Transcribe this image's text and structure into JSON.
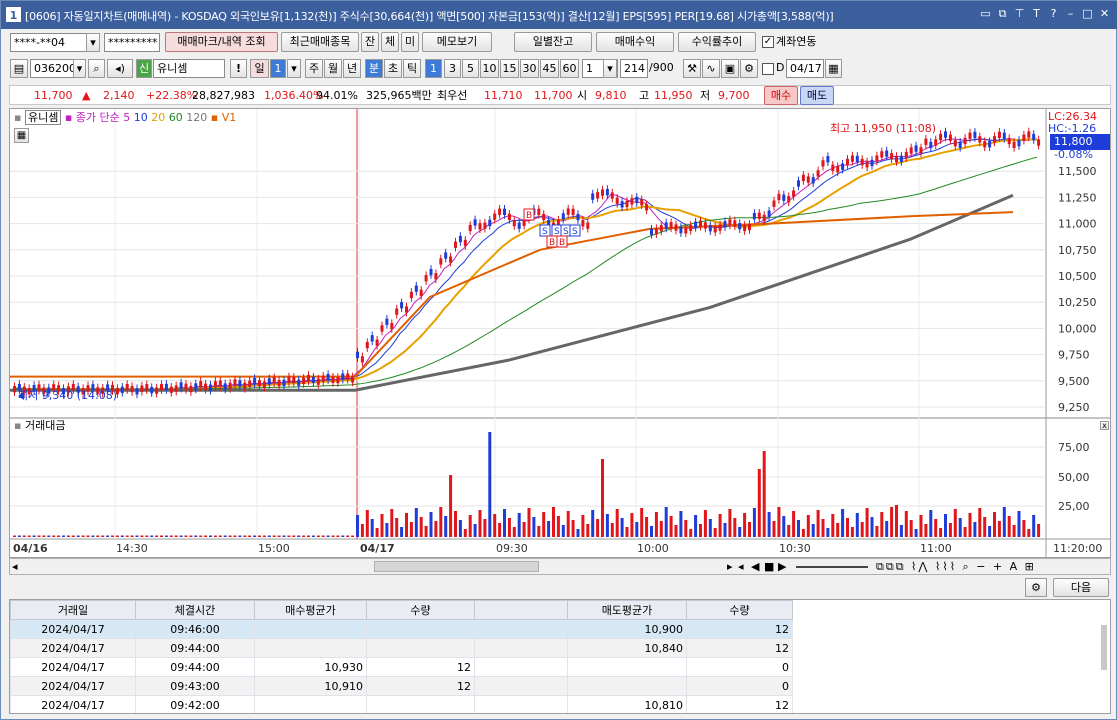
{
  "title": {
    "num": "1",
    "text": "[0606] 자동일지차트(매매내역) - KOSDAQ 외국인보유[1,132(천)] 주식수[30,664(천)] 액면[500] 자본금[153(억)] 결산[12월] EPS[595] PER[19.68] 시가총액[3,588(억)]"
  },
  "toolbar1": {
    "account": "****-**04",
    "password": "*********",
    "mark_btn": "매매마크/내역 조회",
    "recent_btn": "최근매매종목",
    "j": "잔",
    "c": "체",
    "m": "미",
    "memo_btn": "메모보기",
    "daily_btn": "일별잔고",
    "profit_btn": "매매수익",
    "rate_btn": "수익률추이",
    "link_label": "계좌연동"
  },
  "toolbar2": {
    "code": "036200",
    "market": "신",
    "name": "유니셈",
    "day": "일",
    "day_n": "1",
    "week": "주",
    "month": "월",
    "year": "년",
    "minute": "분",
    "second": "초",
    "tick": "틱",
    "periods": [
      "1",
      "3",
      "5",
      "10",
      "15",
      "30",
      "45",
      "60"
    ],
    "period_sel": "1",
    "count": "214",
    "total": "/900",
    "d_label": "D",
    "date": "04/17"
  },
  "quote": {
    "price": "11,700",
    "arrow": "▲",
    "change": "2,140",
    "pct": "+22.38%",
    "volume": "28,827,983",
    "vol_pct": "1,036.40%",
    "ratio": "94.01%",
    "amount": "325,965백만",
    "best_ask_label": "최우선",
    "ask": "11,710",
    "bid": "11,700",
    "open_label": "시",
    "open": "9,810",
    "high_label": "고",
    "high": "11,950",
    "low_label": "저",
    "low": "9,700",
    "buy_btn": "매수",
    "sell_btn": "매도"
  },
  "chart": {
    "top_legend": {
      "name": "유니셈",
      "ma_label": "종가 단순",
      "ma5": "5",
      "ma10": "10",
      "ma20": "20",
      "ma60": "60",
      "ma120": "120",
      "v": "V1"
    },
    "high_label": "최고 11,950 (11:08)",
    "low_label": "최저 9,340 (14:08)",
    "lc": "LC:26.34",
    "hc": "HC:-1.26",
    "cur_price": "11,800",
    "cur_pct": "-0.08%",
    "price_ticks": [
      "11,500",
      "11,250",
      "11,000",
      "10,750",
      "10,500",
      "10,250",
      "10,000",
      "9,750",
      "9,500",
      "9,250"
    ],
    "vol_title": "거래대금",
    "vol_ticks": [
      "75,00",
      "50,00",
      "25,00"
    ],
    "time_labels": [
      "04/16",
      "14:30",
      "15:00",
      "04/17",
      "09:30",
      "10:00",
      "10:30",
      "11:00",
      "11:20:00"
    ]
  },
  "chart_data": {
    "type": "candlestick",
    "ylim": [
      9250,
      11800
    ],
    "high": 11950,
    "low": 9340,
    "current": 11800
  },
  "bottom": {
    "next_btn": "다음"
  },
  "table": {
    "headers": [
      "거래일",
      "체결시간",
      "매수평균가",
      "수량",
      "",
      "매도평균가",
      "수량"
    ],
    "rows": [
      [
        "2024/04/17",
        "09:46:00",
        "",
        "",
        "",
        "10,900",
        "12"
      ],
      [
        "2024/04/17",
        "09:44:00",
        "",
        "",
        "",
        "10,840",
        "12"
      ],
      [
        "2024/04/17",
        "09:44:00",
        "10,930",
        "12",
        "",
        "",
        "0"
      ],
      [
        "2024/04/17",
        "09:43:00",
        "10,910",
        "12",
        "",
        "",
        "0"
      ],
      [
        "2024/04/17",
        "09:42:00",
        "",
        "",
        "",
        "10,810",
        "12"
      ]
    ]
  }
}
